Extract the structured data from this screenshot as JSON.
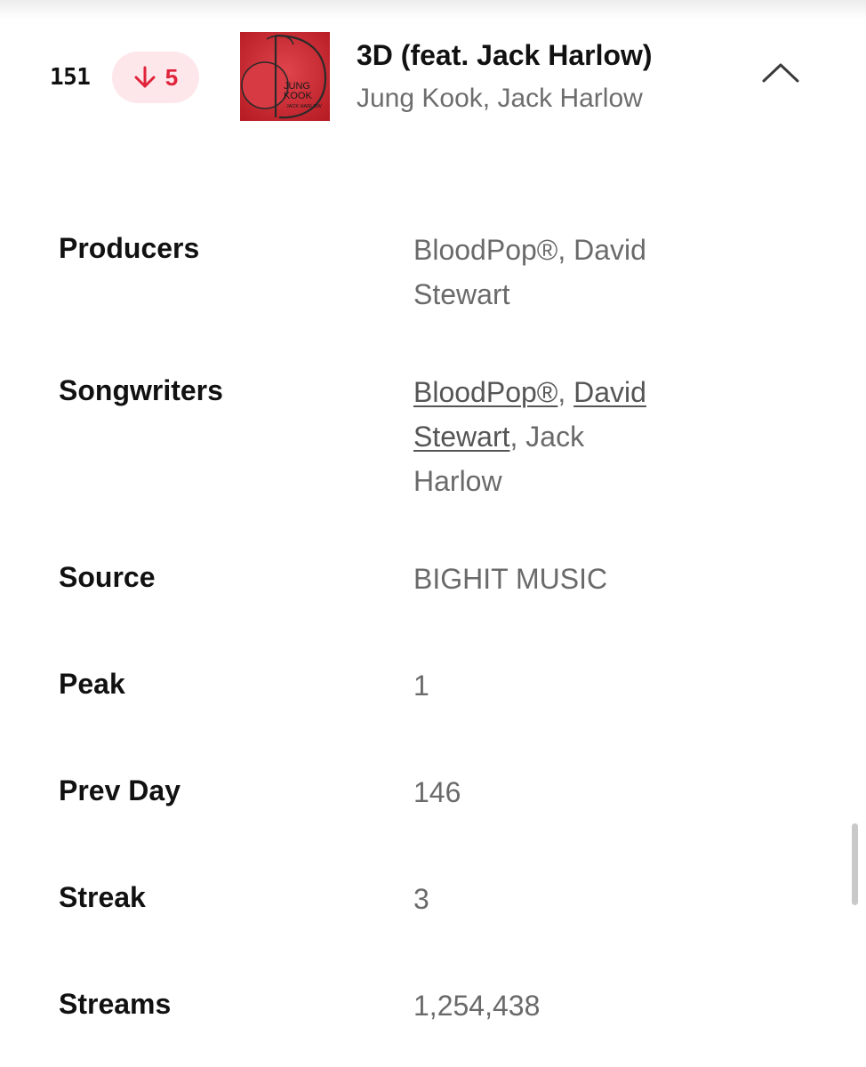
{
  "entry": {
    "rank": "151",
    "change": {
      "direction_icon": "arrow-down-icon",
      "value": "5",
      "color": "#e0223a",
      "badge_color": "#fde7ea"
    },
    "cover": {
      "line1": "JUNG",
      "line2": "KOOK",
      "line3": "JACK HARLOW",
      "color": "#c0242c"
    },
    "title": "3D (feat. Jack Harlow)",
    "artists": "Jung Kook, Jack Harlow",
    "collapse_icon": "chevron-up-icon"
  },
  "details": {
    "producers": {
      "label": "Producers",
      "value": "BloodPop®, David Stewart"
    },
    "songwriters": {
      "label": "Songwriters",
      "links": [
        "BloodPop®",
        "David Stewart"
      ],
      "sep": ", ",
      "rest": ", Jack Harlow"
    },
    "source": {
      "label": "Source",
      "value": "BIGHIT MUSIC"
    },
    "peak": {
      "label": "Peak",
      "value": "1"
    },
    "prev_day": {
      "label": "Prev Day",
      "value": "146"
    },
    "streak": {
      "label": "Streak",
      "value": "3"
    },
    "streams": {
      "label": "Streams",
      "value": "1,254,438"
    }
  }
}
